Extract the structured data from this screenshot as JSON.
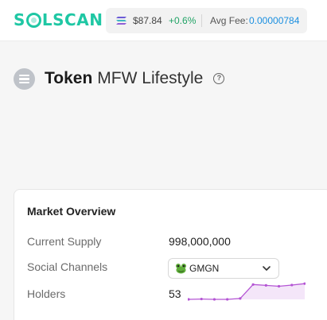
{
  "header": {
    "logo_text_pre": "S",
    "logo_text_post": "LSCAN",
    "sol_price": "$87.84",
    "sol_change": "+0.6%",
    "fee_label": "Avg Fee:",
    "fee_value": "0.00000784"
  },
  "token": {
    "heading": "Token",
    "name": "MFW Lifestyle",
    "help_glyph": "?"
  },
  "market_overview": {
    "title": "Market Overview",
    "rows": [
      {
        "label": "Current Supply",
        "value": "998,000,000"
      },
      {
        "label": "Social Channels",
        "value": "GMGN"
      },
      {
        "label": "Holders",
        "value": "53"
      }
    ],
    "holders_trend": [
      0.0,
      0.02,
      0.0,
      0.0,
      0.05,
      0.85,
      0.8,
      0.75,
      0.82,
      0.9
    ],
    "select_icon": "frog-icon",
    "select_chevron": "chevron-down-icon"
  },
  "colors": {
    "brand": "#1fc7a4",
    "positive": "#21a366",
    "link": "#1a8fe0",
    "sparkline": "#b455d4"
  }
}
